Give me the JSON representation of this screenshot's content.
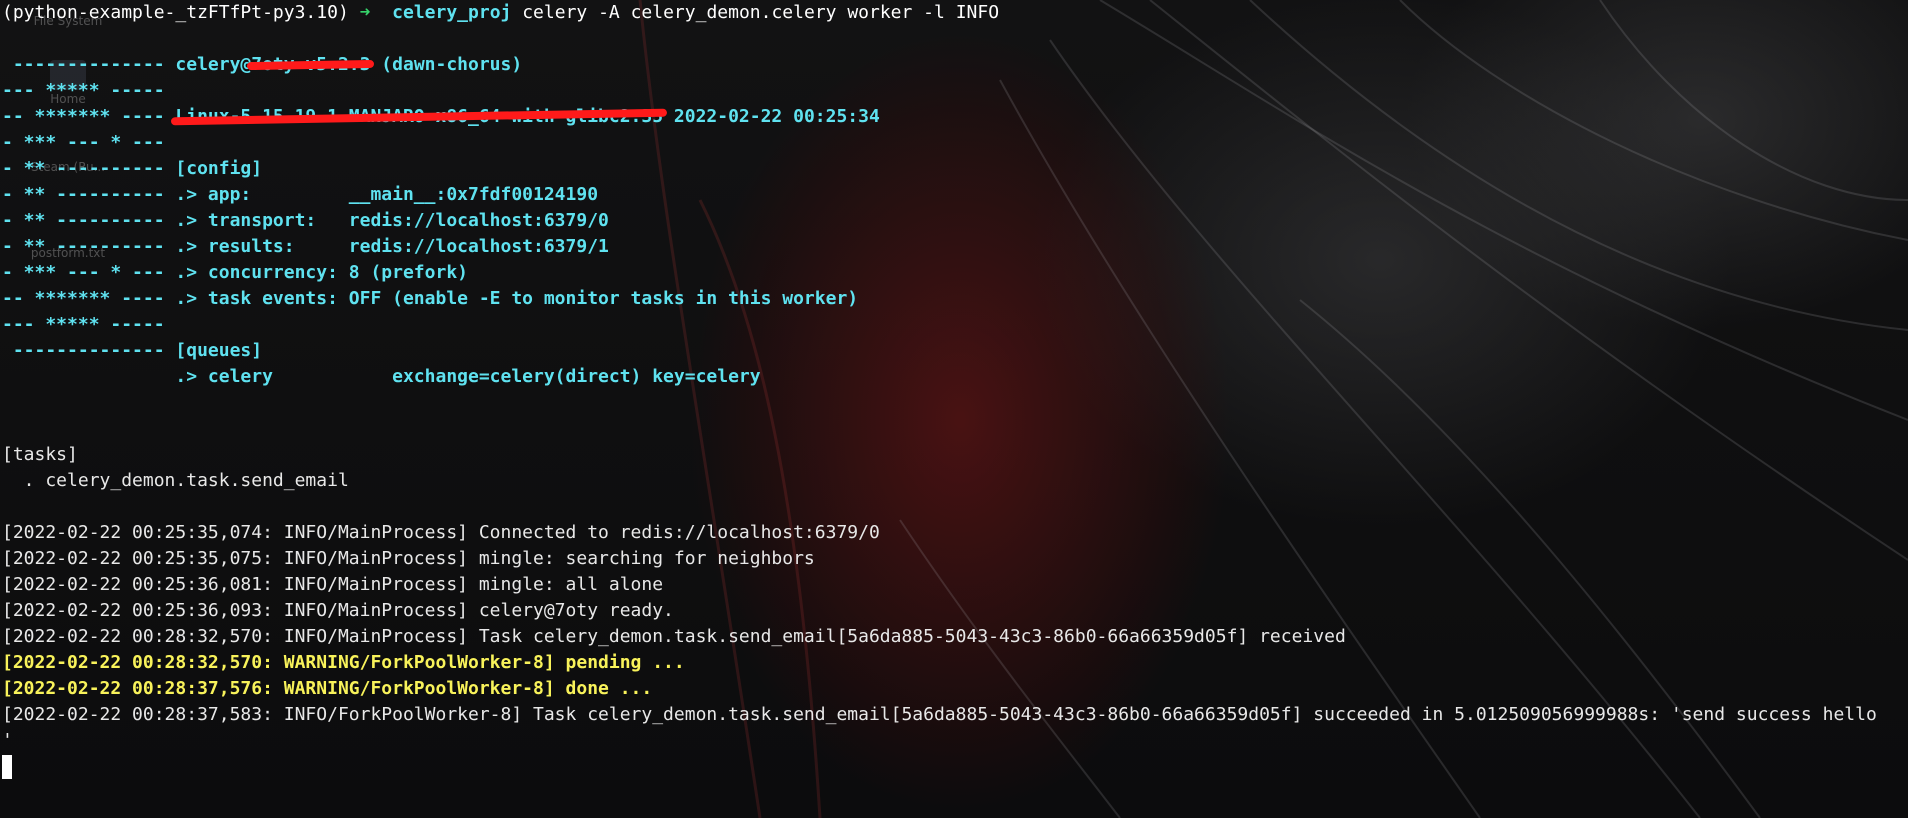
{
  "terminal": {
    "prompt": {
      "env": "(python-example-_tzFTfPt-py3.10)",
      "arrow": "➜",
      "dir": "celery_proj",
      "command": "celery -A celery_demon.celery worker -l INFO"
    },
    "banner": [
      {
        "left": " -------------- ",
        "right": "celery@",
        "redacted": "7oty v5.2.3",
        "tail": " (dawn-chorus)"
      },
      {
        "left": "--- ***** -----",
        "right": ""
      },
      {
        "left": "-- ******* ---- ",
        "redacted": "Linux-5.15.19-1-MANJARO-x86_64-with-glibc2.35",
        "tail": " 2022-02-22 00:25:34"
      },
      {
        "left": "- *** --- * ---",
        "right": ""
      },
      {
        "left": "- ** ---------- ",
        "right": "[config]"
      },
      {
        "left": "- ** ---------- ",
        "right": ".> app:         __main__:0x7fdf00124190"
      },
      {
        "left": "- ** ---------- ",
        "right": ".> transport:   redis://localhost:6379/0"
      },
      {
        "left": "- ** ---------- ",
        "right": ".> results:     redis://localhost:6379/1"
      },
      {
        "left": "- *** --- * --- ",
        "right": ".> concurrency: 8 (prefork)"
      },
      {
        "left": "-- ******* ---- ",
        "right": ".> task events: OFF (enable -E to monitor tasks in this worker)"
      },
      {
        "left": "--- ***** -----",
        "right": ""
      },
      {
        "left": " -------------- ",
        "right": "[queues]"
      },
      {
        "left": "                ",
        "right": ".> celery           exchange=celery(direct) key=celery"
      }
    ],
    "tasks_header": "[tasks]",
    "tasks": [
      "  . celery_demon.task.send_email"
    ],
    "log": [
      {
        "level": "info",
        "text": "[2022-02-22 00:25:35,074: INFO/MainProcess] Connected to redis://localhost:6379/0"
      },
      {
        "level": "info",
        "text": "[2022-02-22 00:25:35,075: INFO/MainProcess] mingle: searching for neighbors"
      },
      {
        "level": "info",
        "text": "[2022-02-22 00:25:36,081: INFO/MainProcess] mingle: all alone"
      },
      {
        "level": "info",
        "text": "[2022-02-22 00:25:36,093: INFO/MainProcess] celery@7oty ready."
      },
      {
        "level": "info",
        "text": "[2022-02-22 00:28:32,570: INFO/MainProcess] Task celery_demon.task.send_email[5a6da885-5043-43c3-86b0-66a66359d05f] received"
      },
      {
        "level": "warn",
        "text": "[2022-02-22 00:28:32,570: WARNING/ForkPoolWorker-8] pending ..."
      },
      {
        "level": "warn",
        "text": "[2022-02-22 00:28:37,576: WARNING/ForkPoolWorker-8] done ..."
      },
      {
        "level": "info",
        "text": "[2022-02-22 00:28:37,583: INFO/ForkPoolWorker-8] Task celery_demon.task.send_email[5a6da885-5043-43c3-86b0-66a66359d05f] succeeded in 5.012509056999988s: 'send success hello"
      },
      {
        "level": "info",
        "text": "'"
      }
    ]
  },
  "desktop_icons": [
    "File System",
    "Home",
    "Steam (Ru...",
    "postform.txt"
  ],
  "colors": {
    "accent_cyan": "#5fe2f0",
    "warning_yellow": "#f8f25a",
    "prompt_green": "#36d36b",
    "redaction_red": "#ff1a1a"
  }
}
